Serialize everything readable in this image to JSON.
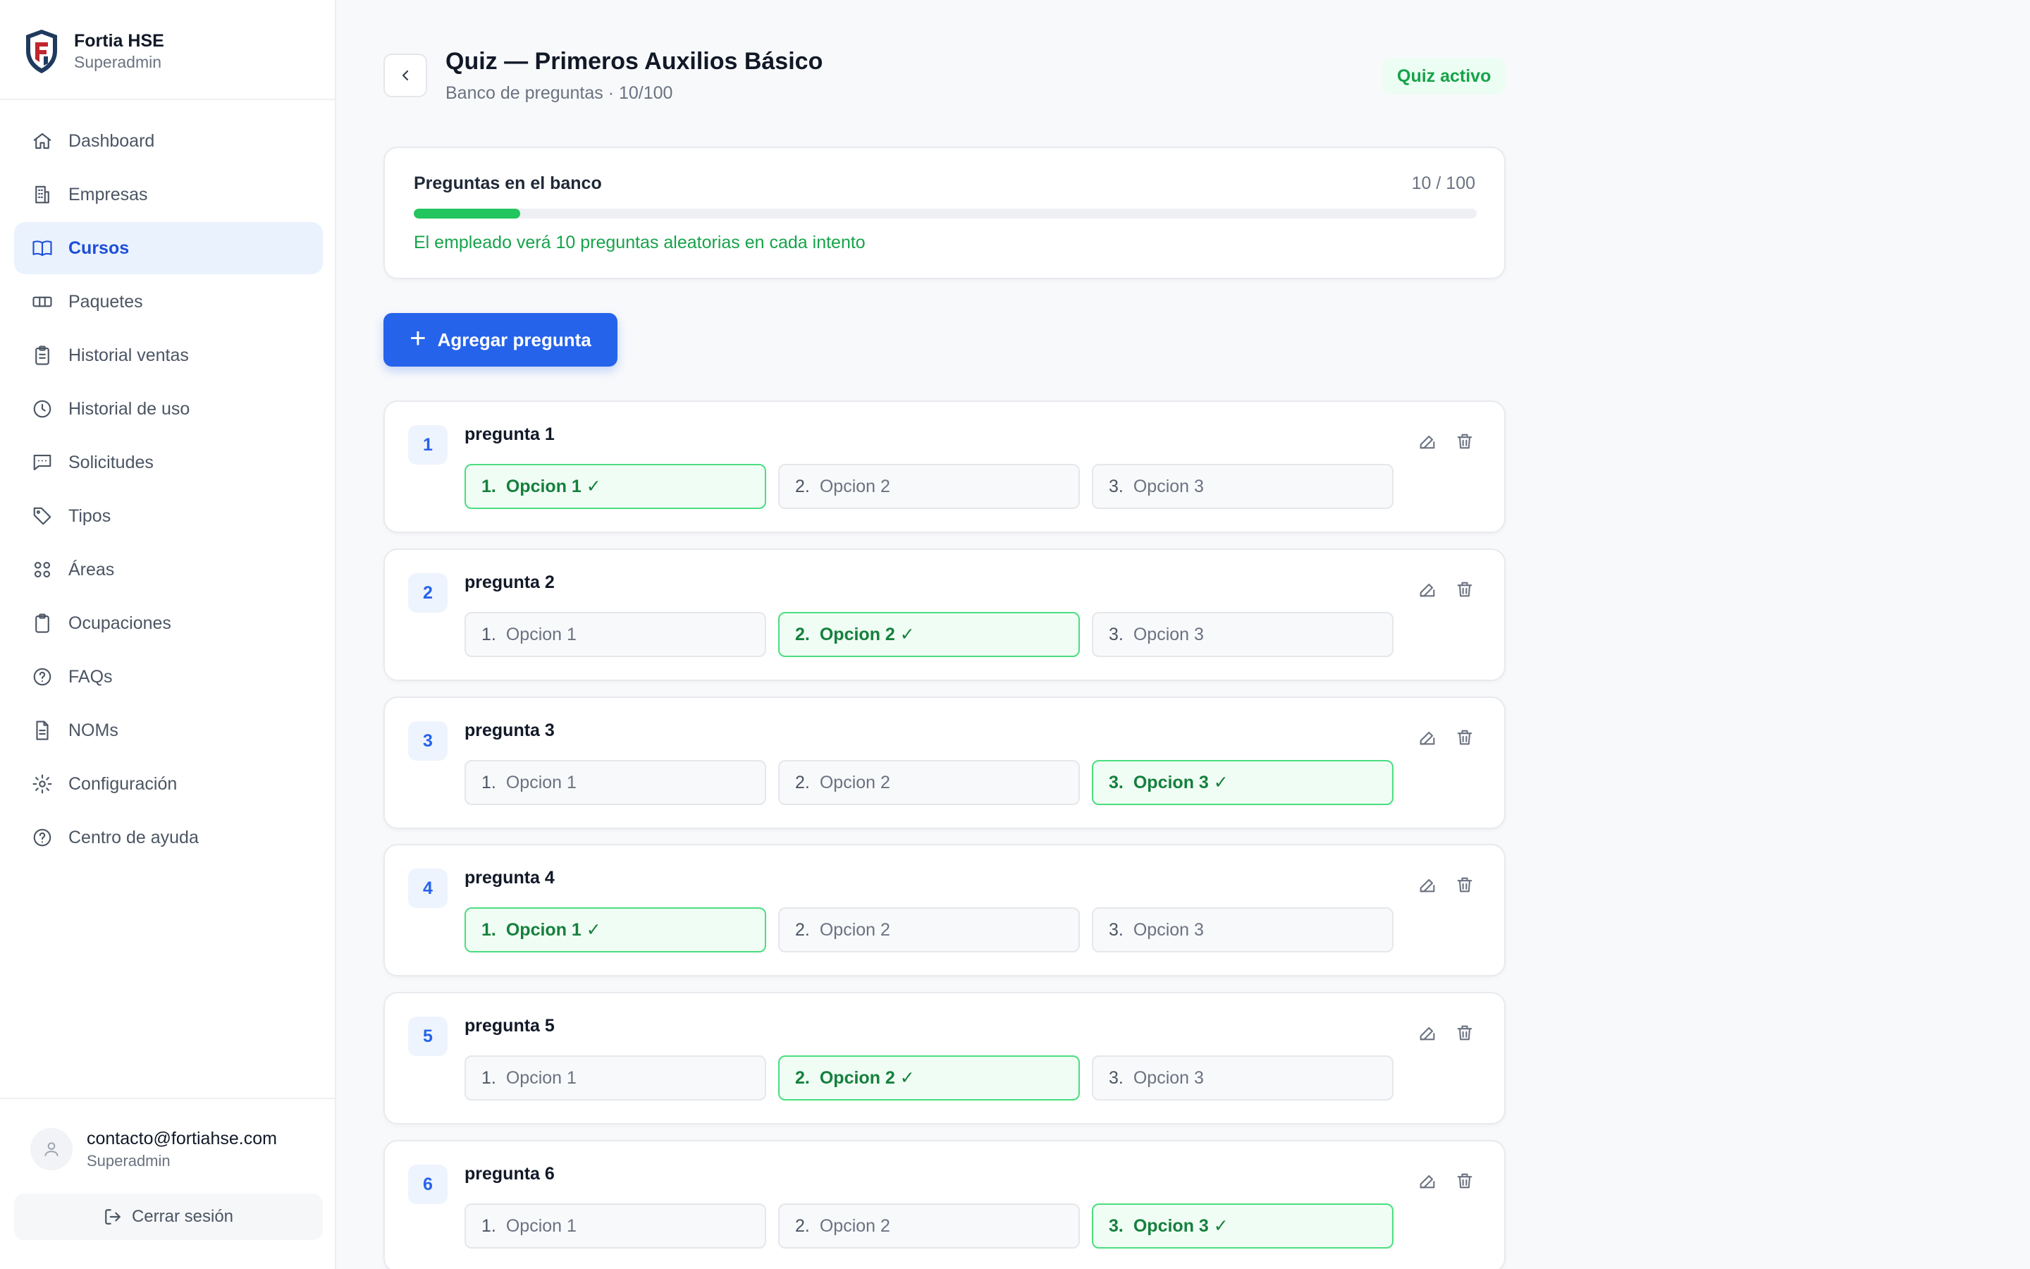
{
  "brand": {
    "name": "Fortia HSE",
    "role": "Superadmin"
  },
  "nav": [
    {
      "label": "Dashboard",
      "icon": "home-icon",
      "active": false
    },
    {
      "label": "Empresas",
      "icon": "building-icon",
      "active": false
    },
    {
      "label": "Cursos",
      "icon": "book-icon",
      "active": true
    },
    {
      "label": "Paquetes",
      "icon": "ticket-icon",
      "active": false
    },
    {
      "label": "Historial ventas",
      "icon": "clipboard-icon",
      "active": false
    },
    {
      "label": "Historial de uso",
      "icon": "clock-icon",
      "active": false
    },
    {
      "label": "Solicitudes",
      "icon": "message-icon",
      "active": false
    },
    {
      "label": "Tipos",
      "icon": "tag-icon",
      "active": false
    },
    {
      "label": "Áreas",
      "icon": "grid-icon",
      "active": false
    },
    {
      "label": "Ocupaciones",
      "icon": "clipboard-list-icon",
      "active": false
    },
    {
      "label": "FAQs",
      "icon": "help-circle-icon",
      "active": false
    },
    {
      "label": "NOMs",
      "icon": "document-icon",
      "active": false
    },
    {
      "label": "Configuración",
      "icon": "gear-icon",
      "active": false
    },
    {
      "label": "Centro de ayuda",
      "icon": "help-icon",
      "active": false
    }
  ],
  "user": {
    "email": "contacto@fortiahse.com",
    "role": "Superadmin",
    "logout_label": "Cerrar sesión"
  },
  "header": {
    "title": "Quiz — Primeros Auxilios Básico",
    "subtitle": "Banco de preguntas · 10/100",
    "status_badge": "Quiz activo"
  },
  "bank": {
    "label": "Preguntas en el banco",
    "count_text": "10 / 100",
    "progress": 0.1,
    "note": "El empleado verá 10 preguntas aleatorias en cada intento"
  },
  "add_button_label": "Agregar pregunta",
  "colors": {
    "accent": "#2563eb",
    "success": "#16a34a",
    "active_nav_bg": "#eaf2fd"
  },
  "questions": [
    {
      "number": "1",
      "text": "pregunta 1",
      "options": [
        {
          "idx": "1.",
          "label": "Opcion 1",
          "mark": "✓",
          "correct": true
        },
        {
          "idx": "2.",
          "label": "Opcion 2",
          "mark": "",
          "correct": false
        },
        {
          "idx": "3.",
          "label": "Opcion 3",
          "mark": "",
          "correct": false
        }
      ]
    },
    {
      "number": "2",
      "text": "pregunta 2",
      "options": [
        {
          "idx": "1.",
          "label": "Opcion 1",
          "mark": "",
          "correct": false
        },
        {
          "idx": "2.",
          "label": "Opcion 2",
          "mark": "✓",
          "correct": true
        },
        {
          "idx": "3.",
          "label": "Opcion 3",
          "mark": "",
          "correct": false
        }
      ]
    },
    {
      "number": "3",
      "text": "pregunta 3",
      "options": [
        {
          "idx": "1.",
          "label": "Opcion 1",
          "mark": "",
          "correct": false
        },
        {
          "idx": "2.",
          "label": "Opcion 2",
          "mark": "",
          "correct": false
        },
        {
          "idx": "3.",
          "label": "Opcion 3",
          "mark": "✓",
          "correct": true
        }
      ]
    },
    {
      "number": "4",
      "text": "pregunta 4",
      "options": [
        {
          "idx": "1.",
          "label": "Opcion 1",
          "mark": "✓",
          "correct": true
        },
        {
          "idx": "2.",
          "label": "Opcion 2",
          "mark": "",
          "correct": false
        },
        {
          "idx": "3.",
          "label": "Opcion 3",
          "mark": "",
          "correct": false
        }
      ]
    },
    {
      "number": "5",
      "text": "pregunta 5",
      "options": [
        {
          "idx": "1.",
          "label": "Opcion 1",
          "mark": "",
          "correct": false
        },
        {
          "idx": "2.",
          "label": "Opcion 2",
          "mark": "✓",
          "correct": true
        },
        {
          "idx": "3.",
          "label": "Opcion 3",
          "mark": "",
          "correct": false
        }
      ]
    },
    {
      "number": "6",
      "text": "pregunta 6",
      "options": [
        {
          "idx": "1.",
          "label": "Opcion 1",
          "mark": "",
          "correct": false
        },
        {
          "idx": "2.",
          "label": "Opcion 2",
          "mark": "",
          "correct": false
        },
        {
          "idx": "3.",
          "label": "Opcion 3",
          "mark": "✓",
          "correct": true
        }
      ]
    }
  ]
}
